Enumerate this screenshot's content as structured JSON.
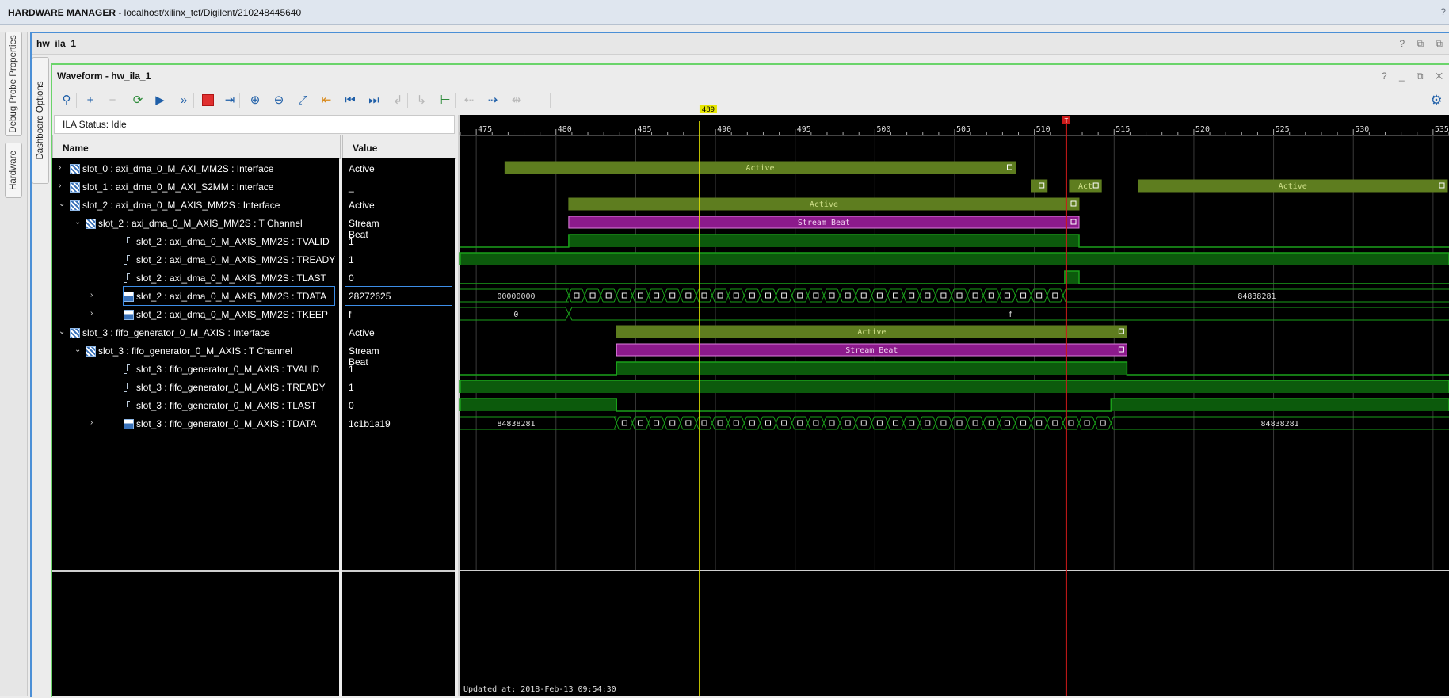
{
  "window": {
    "title_strong": "HARDWARE MANAGER",
    "title_rest": " - localhost/xilinx_tcf/Digilent/210248445640",
    "help": "?"
  },
  "side_tabs": {
    "debug_probe_properties": "Debug Probe Properties",
    "hardware": "Hardware",
    "dashboard_options": "Dashboard Options"
  },
  "panel": {
    "title": "hw_ila_1",
    "buttons": "? ⧉ ⧉"
  },
  "waveform_panel": {
    "title": "Waveform - hw_ila_1",
    "buttons": "? _ ⧉ ✕"
  },
  "toolbar": {
    "icons": [
      {
        "name": "search-icon",
        "glyph": "⚲",
        "style": "blue"
      },
      {
        "name": "add-icon",
        "glyph": "+",
        "style": "blue"
      },
      {
        "name": "remove-icon",
        "glyph": "−",
        "style": "grey"
      },
      {
        "name": "run-trigger-immediate-icon",
        "glyph": "⟳",
        "style": "green"
      },
      {
        "name": "run-trigger-icon",
        "glyph": "▶",
        "style": "blue"
      },
      {
        "name": "auto-retrigger-icon",
        "glyph": "»",
        "style": "blue"
      },
      {
        "name": "stop-icon",
        "glyph": "",
        "style": "red"
      },
      {
        "name": "export-icon",
        "glyph": "⇥",
        "style": "blue"
      },
      {
        "name": "zoom-in-icon",
        "glyph": "⊕",
        "style": "blue"
      },
      {
        "name": "zoom-out-icon",
        "glyph": "⊖",
        "style": "blue"
      },
      {
        "name": "zoom-fit-icon",
        "glyph": "⤢",
        "style": "blue"
      },
      {
        "name": "go-to-cursor-icon",
        "glyph": "⇤",
        "style": "orange"
      },
      {
        "name": "go-to-start-icon",
        "glyph": "⏮",
        "style": "blue"
      },
      {
        "name": "go-to-end-icon",
        "glyph": "⏭",
        "style": "blue"
      },
      {
        "name": "previous-transition-icon",
        "glyph": "↲",
        "style": "grey"
      },
      {
        "name": "next-transition-icon",
        "glyph": "↳",
        "style": "grey"
      },
      {
        "name": "add-marker-icon",
        "glyph": "⊢",
        "style": "green"
      },
      {
        "name": "previous-marker-icon",
        "glyph": "⇠",
        "style": "grey"
      },
      {
        "name": "next-marker-icon",
        "glyph": "⇢",
        "style": "blue"
      },
      {
        "name": "swap-cursors-icon",
        "glyph": "⇹",
        "style": "grey"
      }
    ],
    "settings_icon": "⚙"
  },
  "ila_status": "ILA Status:  Idle",
  "columns": {
    "name": "Name",
    "value": "Value"
  },
  "signals": [
    {
      "label": "slot_0 : axi_dma_0_M_AXI_MM2S : Interface",
      "value": "Active",
      "indent": 0,
      "icon": "if",
      "expander": "›"
    },
    {
      "label": "slot_1 : axi_dma_0_M_AXI_S2MM : Interface",
      "value": "_",
      "indent": 0,
      "icon": "if",
      "expander": "›"
    },
    {
      "label": "slot_2 : axi_dma_0_M_AXIS_MM2S : Interface",
      "value": "Active",
      "indent": 0,
      "icon": "if",
      "expander": "⌄"
    },
    {
      "label": "slot_2 : axi_dma_0_M_AXIS_MM2S : T Channel",
      "value": "Stream Beat",
      "indent": 1,
      "icon": "if",
      "expander": "⌄"
    },
    {
      "label": "slot_2 : axi_dma_0_M_AXIS_MM2S : TVALID",
      "value": "1",
      "indent": 2,
      "icon": "bit",
      "expander": ""
    },
    {
      "label": "slot_2 : axi_dma_0_M_AXIS_MM2S : TREADY",
      "value": "1",
      "indent": 2,
      "icon": "bit",
      "expander": ""
    },
    {
      "label": "slot_2 : axi_dma_0_M_AXIS_MM2S : TLAST",
      "value": "0",
      "indent": 2,
      "icon": "bit",
      "expander": ""
    },
    {
      "label": "slot_2 : axi_dma_0_M_AXIS_MM2S : TDATA",
      "value": "28272625",
      "indent": 2,
      "icon": "bus",
      "expander": "›",
      "selected": true
    },
    {
      "label": "slot_2 : axi_dma_0_M_AXIS_MM2S : TKEEP",
      "value": "f",
      "indent": 2,
      "icon": "bus",
      "expander": "›"
    },
    {
      "label": "slot_3 : fifo_generator_0_M_AXIS : Interface",
      "value": "Active",
      "indent": 0,
      "icon": "if",
      "expander": "⌄"
    },
    {
      "label": "slot_3 : fifo_generator_0_M_AXIS : T Channel",
      "value": "Stream Beat",
      "indent": 1,
      "icon": "if",
      "expander": "⌄"
    },
    {
      "label": "slot_3 : fifo_generator_0_M_AXIS : TVALID",
      "value": "1",
      "indent": 2,
      "icon": "bit",
      "expander": ""
    },
    {
      "label": "slot_3 : fifo_generator_0_M_AXIS : TREADY",
      "value": "1",
      "indent": 2,
      "icon": "bit",
      "expander": ""
    },
    {
      "label": "slot_3 : fifo_generator_0_M_AXIS : TLAST",
      "value": "0",
      "indent": 2,
      "icon": "bit",
      "expander": ""
    },
    {
      "label": "slot_3 : fifo_generator_0_M_AXIS : TDATA",
      "value": "1c1b1a19",
      "indent": 2,
      "icon": "bus",
      "expander": "›"
    }
  ],
  "timeline": {
    "start": 474,
    "end": 536,
    "major_ticks": [
      475,
      480,
      485,
      490,
      495,
      500,
      505,
      510,
      515,
      520,
      525,
      530,
      535
    ],
    "cursor_sample": 489,
    "cursor_label": "489",
    "trigger_sample": 512,
    "trigger_label": "T",
    "updated": "Updated at: 2018-Feb-13 09:54:30"
  },
  "waves": [
    {
      "type": "bars",
      "color": "#5e7d1f",
      "text_color": "#cfe08a",
      "segments": [
        {
          "from": 476.8,
          "to": 508.8,
          "text": "Active"
        }
      ]
    },
    {
      "type": "bars",
      "color": "#5e7d1f",
      "text_color": "#cfe08a",
      "segments": [
        {
          "from": 509.8,
          "to": 510.8,
          "text": ""
        },
        {
          "from": 512.2,
          "to": 514.2,
          "text": "Act"
        },
        {
          "from": 516.5,
          "to": 535.9,
          "text": "Active"
        }
      ]
    },
    {
      "type": "bars",
      "color": "#5e7d1f",
      "text_color": "#cfe08a",
      "segments": [
        {
          "from": 480.8,
          "to": 512.8,
          "text": "Active"
        }
      ]
    },
    {
      "type": "bars",
      "color": "#8c1a8c",
      "text_color": "#f0d0f0",
      "border": "#e080e0",
      "segments": [
        {
          "from": 480.8,
          "to": 512.8,
          "text": "Stream Beat"
        }
      ]
    },
    {
      "type": "bit",
      "high": [
        [
          480.8,
          512.8
        ]
      ]
    },
    {
      "type": "bit",
      "high": [
        [
          474,
          536
        ]
      ]
    },
    {
      "type": "bit",
      "high": [
        [
          511.9,
          512.8
        ]
      ]
    },
    {
      "type": "bus",
      "left_text": "00000000",
      "right_text": "84838281",
      "start": 480.8,
      "end": 511.9,
      "split": 477.5
    },
    {
      "type": "bus",
      "left_text": "0",
      "right_text": "f",
      "start": 480.8,
      "end": 480.8,
      "split": 477.5,
      "single": true
    },
    {
      "type": "bars",
      "color": "#5e7d1f",
      "text_color": "#cfe08a",
      "segments": [
        {
          "from": 483.8,
          "to": 515.8,
          "text": "Active"
        }
      ]
    },
    {
      "type": "bars",
      "color": "#8c1a8c",
      "text_color": "#f0d0f0",
      "border": "#e080e0",
      "segments": [
        {
          "from": 483.8,
          "to": 515.8,
          "text": "Stream Beat"
        }
      ]
    },
    {
      "type": "bit",
      "high": [
        [
          483.8,
          515.8
        ]
      ]
    },
    {
      "type": "bit",
      "high": [
        [
          474,
          536
        ]
      ]
    },
    {
      "type": "bit",
      "high": [
        [
          474,
          483.8
        ],
        [
          514.8,
          536
        ]
      ]
    },
    {
      "type": "bus",
      "left_text": "84838281",
      "right_text": "84838281",
      "start": 483.8,
      "end": 514.8,
      "split": 477.5
    }
  ],
  "colors": {
    "wave_green": "#1aa01a",
    "wave_fill": "#0c5a0c",
    "cursor": "#e6e600",
    "trigger": "#cc1a1a",
    "grid": "#3a3a3a"
  }
}
